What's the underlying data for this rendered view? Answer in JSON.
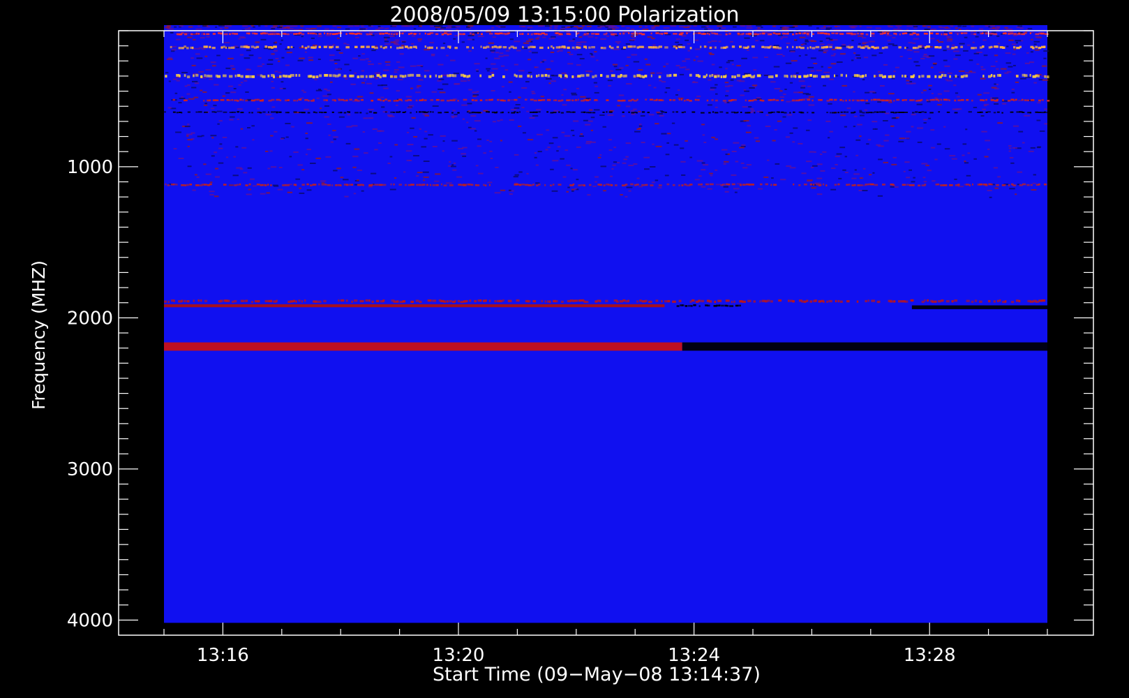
{
  "chart_data": {
    "type": "heatmap",
    "title": "2008/05/09 13:15:00 Polarization",
    "xlabel": "Start Time (09−May−08 13:14:37)",
    "ylabel": "Frequency (MHZ)",
    "x_ticks": [
      {
        "label": "13:16",
        "minutes": 16
      },
      {
        "label": "13:20",
        "minutes": 20
      },
      {
        "label": "13:24",
        "minutes": 24
      },
      {
        "label": "13:28",
        "minutes": 28
      }
    ],
    "x_range_minutes": [
      15,
      30
    ],
    "x_minor_tick_minutes": 1,
    "y_ticks": [
      1000,
      2000,
      3000,
      4000
    ],
    "y_minor_tick_mhz": 100,
    "y_axis_range": [
      4100,
      100
    ],
    "data_range_mhz": [
      100,
      4000
    ],
    "background_color": "#1010f0",
    "colors": {
      "page": "#000000",
      "axes": "#ffffff",
      "strong_positive": "#cc1010",
      "weak": "#000000",
      "bright": "#ffd040"
    },
    "bands": [
      {
        "freq_mhz": 120,
        "width_mhz": 20,
        "color": "#ff3020",
        "start_min": 15,
        "end_min": 30,
        "style": "speckle"
      },
      {
        "freq_mhz": 210,
        "width_mhz": 25,
        "color": "#ffb040",
        "start_min": 15,
        "end_min": 30,
        "style": "speckle"
      },
      {
        "freq_mhz": 400,
        "width_mhz": 30,
        "color": "#ffd040",
        "start_min": 15,
        "end_min": 30,
        "style": "speckle"
      },
      {
        "freq_mhz": 560,
        "width_mhz": 20,
        "color": "#d02020",
        "start_min": 15,
        "end_min": 30,
        "style": "speckle"
      },
      {
        "freq_mhz": 640,
        "width_mhz": 15,
        "color": "#000000",
        "start_min": 15,
        "end_min": 30,
        "style": "speckle"
      },
      {
        "freq_mhz": 1120,
        "width_mhz": 20,
        "color": "#c02020",
        "start_min": 15,
        "end_min": 30,
        "style": "speckle"
      },
      {
        "freq_mhz": 1890,
        "width_mhz": 25,
        "color": "#c01515",
        "start_min": 15,
        "end_min": 30,
        "style": "speckle"
      },
      {
        "freq_mhz": 1920,
        "width_mhz": 20,
        "color": "#b01010",
        "start_min": 15,
        "end_min": 23.5,
        "style": "solid"
      },
      {
        "freq_mhz": 1920,
        "width_mhz": 20,
        "color": "#000000",
        "start_min": 23.6,
        "end_min": 24.8,
        "style": "speckle"
      },
      {
        "freq_mhz": 1930,
        "width_mhz": 25,
        "color": "#000000",
        "start_min": 27.7,
        "end_min": 30,
        "style": "solid"
      },
      {
        "freq_mhz": 2190,
        "width_mhz": 55,
        "color": "#cc1010",
        "start_min": 15,
        "end_min": 23.8,
        "style": "solid"
      },
      {
        "freq_mhz": 2190,
        "width_mhz": 55,
        "color": "#000000",
        "start_min": 23.8,
        "end_min": 30,
        "style": "solid"
      }
    ]
  }
}
